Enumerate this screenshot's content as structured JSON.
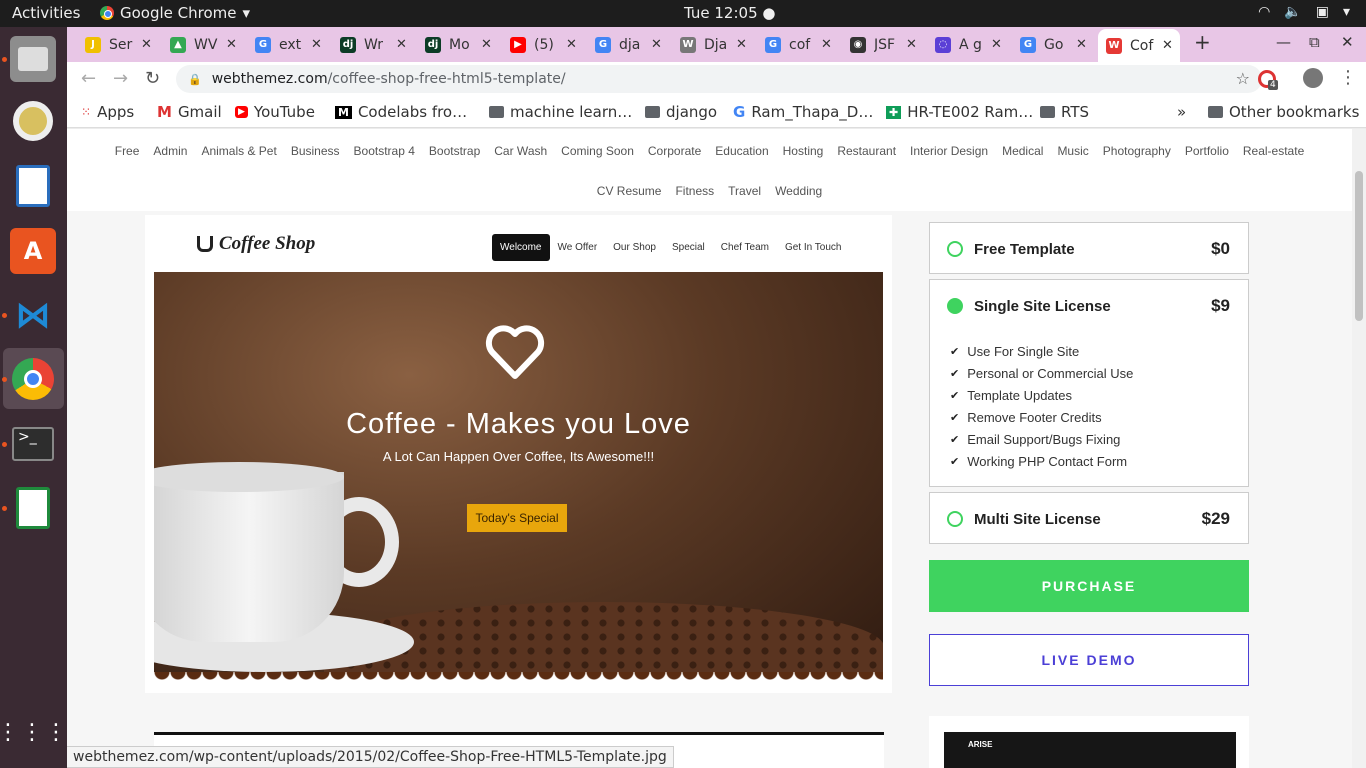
{
  "system": {
    "activities": "Activities",
    "app_name": "Google Chrome",
    "clock": "Tue 12:05"
  },
  "tabs": [
    {
      "title": "Ser",
      "favicon_color": "#f0c000",
      "favicon_text": "J"
    },
    {
      "title": "WV",
      "favicon_color": "#34a853",
      "favicon_text": "▲"
    },
    {
      "title": "ext",
      "favicon_color": "#4285f4",
      "favicon_text": "G"
    },
    {
      "title": "Wr",
      "favicon_color": "#0c3c26",
      "favicon_text": "dj"
    },
    {
      "title": "Mo",
      "favicon_color": "#0c3c26",
      "favicon_text": "dj"
    },
    {
      "title": "(5)",
      "favicon_color": "#ff0000",
      "favicon_text": "▶"
    },
    {
      "title": "dja",
      "favicon_color": "#4285f4",
      "favicon_text": "G"
    },
    {
      "title": "Dja",
      "favicon_color": "#777777",
      "favicon_text": "W"
    },
    {
      "title": "cof",
      "favicon_color": "#4285f4",
      "favicon_text": "G"
    },
    {
      "title": "JSF",
      "favicon_color": "#333333",
      "favicon_text": "◉"
    },
    {
      "title": "A g",
      "favicon_color": "#5b3fd6",
      "favicon_text": "◌"
    },
    {
      "title": "Go",
      "favicon_color": "#4285f4",
      "favicon_text": "G"
    },
    {
      "title": "Cof",
      "favicon_color": "#e53935",
      "favicon_text": "W",
      "active": true
    }
  ],
  "toolbar": {
    "url_host": "webthemez.com",
    "url_path": "/coffee-shop-free-html5-template/",
    "extension_badge": "4"
  },
  "bookmarks": {
    "apps": "Apps",
    "gmail": "Gmail",
    "youtube": "YouTube",
    "codelabs": "Codelabs fro…",
    "ml": "machine learn…",
    "django": "django",
    "ram": "Ram_Thapa_D…",
    "hr": "HR-TE002 Ram…",
    "rts": "RTS",
    "overflow": "»",
    "other": "Other bookmarks"
  },
  "categories_row1": [
    "Free",
    "Admin",
    "Animals & Pet",
    "Business",
    "Bootstrap 4",
    "Bootstrap",
    "Car Wash",
    "Coming Soon",
    "Corporate",
    "Education",
    "Hosting",
    "Restaurant",
    "Interior Design",
    "Medical",
    "Music",
    "Photography",
    "Portfolio",
    "Real-estate"
  ],
  "categories_row2": [
    "CV Resume",
    "Fitness",
    "Travel",
    "Wedding"
  ],
  "preview": {
    "logo": "Coffee Shop",
    "menu": [
      "Welcome",
      "We Offer",
      "Our Shop",
      "Special",
      "Chef Team",
      "Get In Touch"
    ],
    "headline": "Coffee - Makes you Love",
    "subheadline": "A Lot Can Happen Over Coffee, Its Awesome!!!",
    "cta": "Today's Special"
  },
  "licenses": {
    "free": {
      "name": "Free Template",
      "price": "$0"
    },
    "single": {
      "name": "Single Site License",
      "price": "$9",
      "features": [
        "Use For Single Site",
        "Personal or Commercial Use",
        "Template Updates",
        "Remove Footer Credits",
        "Email Support/Bugs Fixing",
        "Working PHP Contact Form"
      ]
    },
    "multi": {
      "name": "Multi Site License",
      "price": "$29"
    }
  },
  "buttons": {
    "purchase": "PURCHASE",
    "live_demo": "LIVE DEMO"
  },
  "thumb2_brand": "ARISE",
  "status_url": "webthemez.com/wp-content/uploads/2015/02/Coffee-Shop-Free-HTML5-Template.jpg",
  "colors": {
    "accent_green": "#3fd35f",
    "accent_purple": "#4b3fd6",
    "cta_orange": "#e8a60c",
    "tab_strip": "#e8c6e6"
  }
}
